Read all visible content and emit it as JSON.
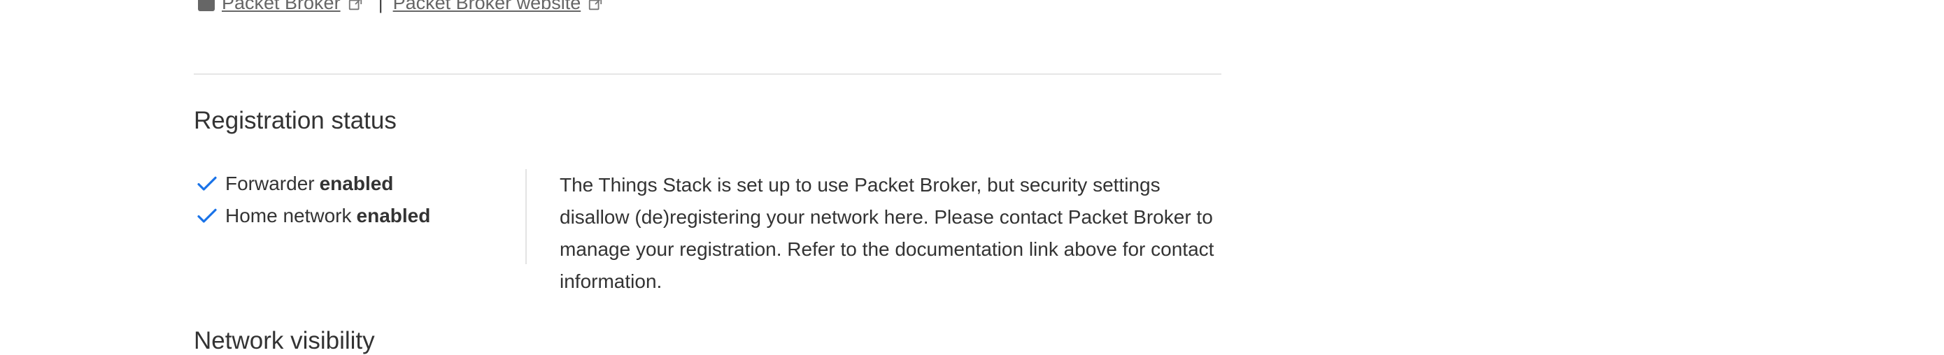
{
  "links": {
    "packet_broker": "Packet Broker",
    "separator": "|",
    "packet_broker_website": "Packet Broker website"
  },
  "registration": {
    "title": "Registration status",
    "items": [
      {
        "label": "Forwarder",
        "value": "enabled",
        "icon": "checkmark-icon"
      },
      {
        "label": "Home network",
        "value": "enabled",
        "icon": "checkmark-icon"
      }
    ],
    "notice": "The Things Stack is set up to use Packet Broker, but security settings disallow (de)registering your network here. Please contact Packet Broker to manage your registration. Refer to the documentation link above for contact information."
  },
  "visibility": {
    "title": "Network visibility"
  },
  "colors": {
    "accent": "#1a73e8",
    "text": "#333333",
    "muted": "#666666",
    "divider": "#e6e6e6"
  }
}
